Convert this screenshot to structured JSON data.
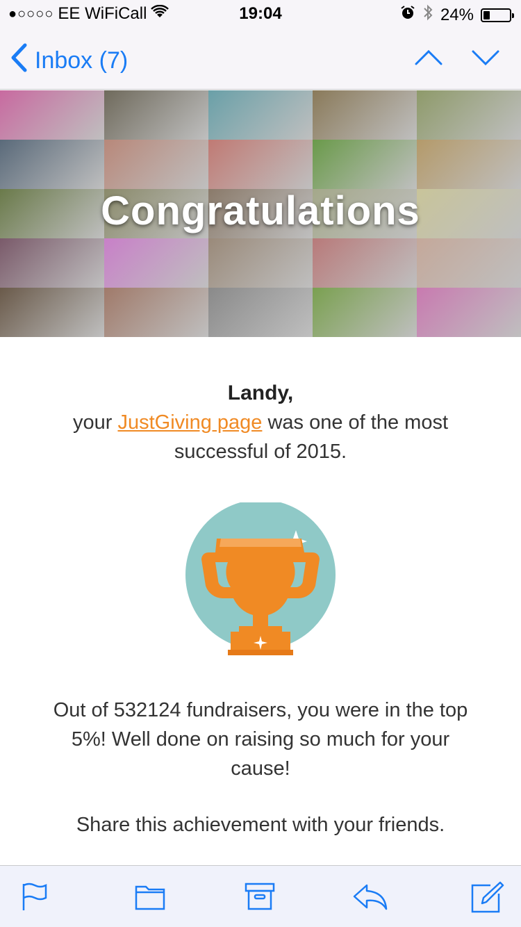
{
  "status_bar": {
    "signal": "●○○○○",
    "carrier": "EE WiFiCall",
    "time": "19:04",
    "battery_pct_text": "24%",
    "battery_fill_fraction": 0.24
  },
  "nav": {
    "back_label": "Inbox (7)",
    "accent": "#1a7cf5"
  },
  "email": {
    "headline": "Congratulations",
    "greeting": "Landy,",
    "intro_pre": "your ",
    "intro_link": "JustGiving page",
    "intro_post": " was one of the most successful of 2015.",
    "stats_text": "Out of 532124 fundraisers, you were in the top 5%! Well done on raising so much for your cause!",
    "share_text": "Share this achievement with your friends.",
    "link_color": "#f08a24",
    "trophy_color": "#f08a24",
    "circle_color": "#8fc9c7"
  },
  "collage_colors": [
    "#c86aa0",
    "#6f6a5c",
    "#6aa0a8",
    "#8a7a5a",
    "#8e9a6a",
    "#5a6a7a",
    "#b8887a",
    "#c07a74",
    "#6a9a4a",
    "#b49a6a",
    "#6a7a4a",
    "#8a8a6a",
    "#8a7a6a",
    "#a4a88a",
    "#c8c49a",
    "#7a5a6a",
    "#c880c8",
    "#9a8a7a",
    "#b87a7a",
    "#c4a89a",
    "#6a5a4a",
    "#a07a6a",
    "#8a8a8a",
    "#7aa050",
    "#c87ab0"
  ],
  "toolbar": {
    "icons": [
      "flag-icon",
      "folder-icon",
      "archive-icon",
      "reply-icon",
      "compose-icon"
    ]
  }
}
